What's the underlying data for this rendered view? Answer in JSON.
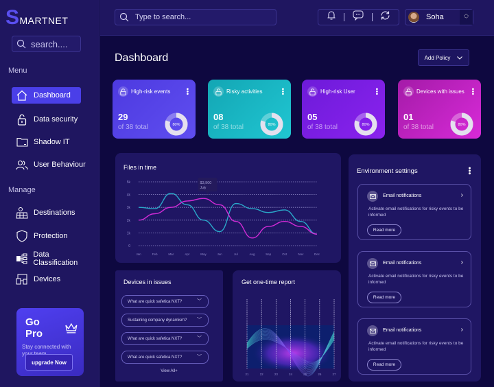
{
  "app": {
    "logo_initial": "S",
    "logo_rest": "MARTNET"
  },
  "sidebar": {
    "search_placeholder": "search....",
    "menu_label": "Menu",
    "manage_label": "Manage",
    "menu_items": [
      {
        "label": "Dashboard",
        "icon": "home-icon",
        "active": true
      },
      {
        "label": "Data security",
        "icon": "lock-icon"
      },
      {
        "label": "Shadow IT",
        "icon": "folder-icon"
      },
      {
        "label": "User Behaviour",
        "icon": "users-icon"
      }
    ],
    "manage_items": [
      {
        "label": "Destinations",
        "icon": "map-icon"
      },
      {
        "label": "Protection",
        "icon": "shield-icon"
      },
      {
        "label": "Data Classification",
        "icon": "hierarchy-icon"
      },
      {
        "label": "Devices",
        "icon": "devices-icon"
      }
    ],
    "promo": {
      "title": "Go Pro",
      "subtitle": "Stay connected with your team",
      "button": "upgrade Now"
    }
  },
  "topbar": {
    "search_placeholder": "Type to search...",
    "user_name": "Soha"
  },
  "page": {
    "title": "Dashboard",
    "add_policy": "Add Policy"
  },
  "stats": [
    {
      "label": "High-risk events",
      "value": "29",
      "total": "of 38  total",
      "percent": 80,
      "percent_label": "80%",
      "color_from": "#4d3ae0",
      "color_to": "#5f4ef0"
    },
    {
      "label": "Risky activities",
      "value": "08",
      "total": "of 38  total",
      "percent": 80,
      "percent_label": "80%",
      "color_from": "#13a6b4",
      "color_to": "#20c6d2"
    },
    {
      "label": "High-risk User",
      "value": "05",
      "total": "of 38  total",
      "percent": 80,
      "percent_label": "80%",
      "color_from": "#6d1bd9",
      "color_to": "#8a22ee"
    },
    {
      "label": "Devices with issues",
      "value": "01",
      "total": "of 38  total",
      "percent": 80,
      "percent_label": "80%",
      "color_from": "#a41ba8",
      "color_to": "#d82ad8"
    }
  ],
  "files_chart": {
    "title": "Files in time",
    "tooltip_value": "$3,900",
    "tooltip_label": "July"
  },
  "chart_data": [
    {
      "type": "line",
      "title": "Files in time",
      "x": [
        "Jan",
        "Feb",
        "Mar",
        "Apr",
        "May",
        "Jun",
        "Jul",
        "Aug",
        "Sep",
        "Oct",
        "Nov",
        "Dec"
      ],
      "yticks": [
        "0",
        "1k",
        "2k",
        "3k",
        "4k",
        "5k"
      ],
      "ylim": [
        0,
        5000
      ],
      "grid": true,
      "series": [
        {
          "name": "cyan",
          "color": "#2aa7c9",
          "values": [
            3000,
            2900,
            4100,
            3200,
            2000,
            1100,
            3300,
            2900,
            2600,
            2800,
            1900,
            900
          ]
        },
        {
          "name": "magenta",
          "color": "#d12bd6",
          "values": [
            2000,
            2500,
            3000,
            3500,
            3700,
            3200,
            1900,
            600,
            1500,
            1900,
            1500,
            900
          ]
        }
      ],
      "annotation": {
        "text": "$3,900 July",
        "x": "May"
      }
    },
    {
      "type": "area",
      "title": "Get one-time report",
      "x": [
        "21",
        "22",
        "23",
        "24",
        "25",
        "26",
        "27"
      ],
      "grid": true
    }
  ],
  "devices": {
    "title": "Devices in issues",
    "items": [
      "What are  quick safetica NXT?",
      "Sustaining company dynamism?",
      "What are  quick safetica NXT?",
      "What are  quick safetica NXT?"
    ],
    "view_all": "View All+"
  },
  "report": {
    "title": "Get one-time report"
  },
  "environment": {
    "title": "Environment settings",
    "items": [
      {
        "title": "Email notifications",
        "desc": "Activate email notifications  for risky events to be informed",
        "button": "Read more"
      },
      {
        "title": "Email notifications",
        "desc": "Activate email notifications  for risky events to be informed",
        "button": "Read more"
      },
      {
        "title": "Email notifications",
        "desc": "Activate email notifications  for risky events to be informed",
        "button": "Read more"
      }
    ]
  }
}
